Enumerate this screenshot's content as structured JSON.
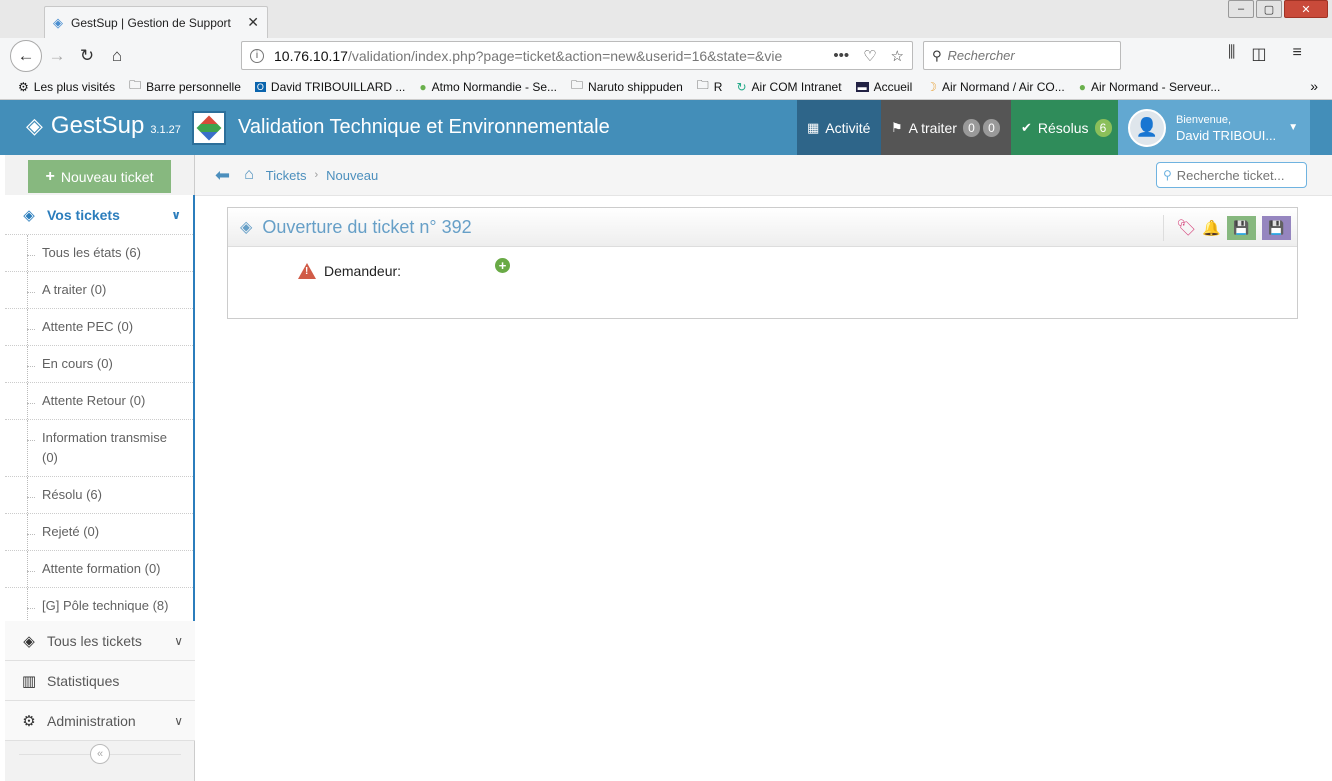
{
  "browser": {
    "tab_title": "GestSup | Gestion de Support",
    "url_host": "10.76.10.17",
    "url_path": "/validation/index.php?page=ticket&action=new&userid=16&state=&vie",
    "search_placeholder": "Rechercher",
    "bookmarks": [
      {
        "label": "Les plus visités",
        "icon": "gear-icon"
      },
      {
        "label": "Barre personnelle",
        "icon": "folder-icon"
      },
      {
        "label": "David TRIBOUILLARD ...",
        "icon": "outlook-icon"
      },
      {
        "label": "Atmo Normandie - Se...",
        "icon": "apple-icon"
      },
      {
        "label": "Naruto shippuden",
        "icon": "folder-icon"
      },
      {
        "label": "R",
        "icon": "folder-icon"
      },
      {
        "label": "Air COM Intranet",
        "icon": "swirl-icon"
      },
      {
        "label": "Accueil",
        "icon": "bed-icon"
      },
      {
        "label": "Air Normand / Air CO...",
        "icon": "moon-icon"
      },
      {
        "label": "Air Normand - Serveur...",
        "icon": "apple-icon"
      }
    ]
  },
  "header": {
    "app_name": "GestSup",
    "version": "3.1.27",
    "title": "Validation Technique et Environnementale",
    "activite_label": "Activité",
    "atraiter_label": "A traiter",
    "atraiter_badges": [
      "0",
      "0"
    ],
    "resolus_label": "Résolus",
    "resolus_badge": "6",
    "welcome": "Bienvenue,",
    "user_name": "David TRIBOUI..."
  },
  "sidebar": {
    "new_ticket_label": "Nouveau ticket",
    "vos_tickets_label": "Vos tickets",
    "items": [
      {
        "label": "Tous les états (6)"
      },
      {
        "label": "A traiter (0)"
      },
      {
        "label": "Attente PEC (0)"
      },
      {
        "label": "En cours (0)"
      },
      {
        "label": "Attente Retour (0)"
      },
      {
        "label": "Information transmise (0)"
      },
      {
        "label": "Résolu (6)"
      },
      {
        "label": "Rejeté (0)"
      },
      {
        "label": "Attente formation (0)"
      },
      {
        "label": "[G] Pôle technique (8)"
      }
    ],
    "tous_tickets_label": "Tous les tickets",
    "statistiques_label": "Statistiques",
    "administration_label": "Administration"
  },
  "breadcrumb": {
    "tickets": "Tickets",
    "nouveau": "Nouveau",
    "search_placeholder": "Recherche ticket..."
  },
  "ticket": {
    "title": "Ouverture du ticket n° 392",
    "demandeur_label": "Demandeur:"
  },
  "colors": {
    "header_bg": "#438eb9",
    "accent": "#2b7dbc",
    "new_ticket_green": "#87b87f",
    "resolus_green": "#2f8c5a"
  }
}
